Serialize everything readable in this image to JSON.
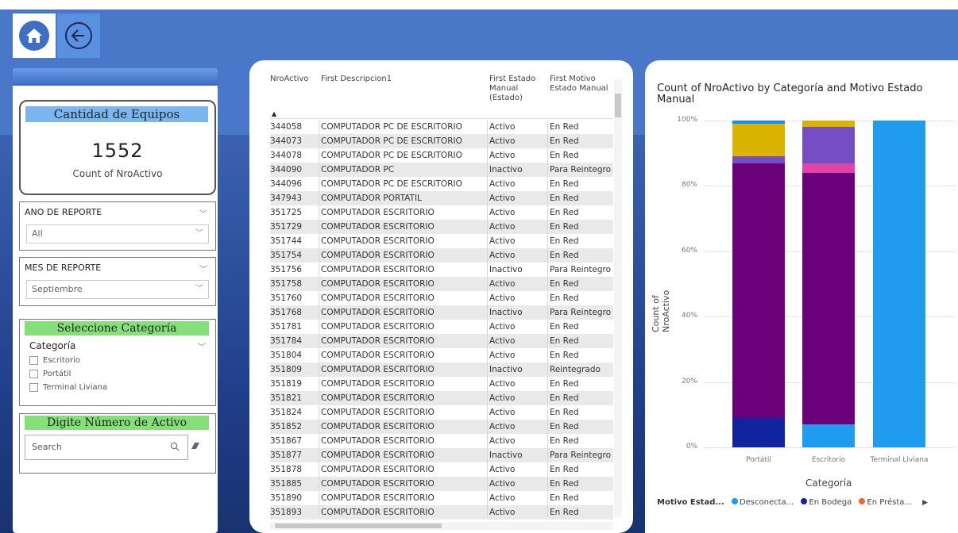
{
  "nav": {
    "home_icon": "home-icon",
    "back_icon": "back-arrow-icon"
  },
  "kpi": {
    "title": "Cantidad de Equipos",
    "value": "1552",
    "label": "Count of NroActivo"
  },
  "slicer_year": {
    "title": "ANO DE REPORTE",
    "value": "All"
  },
  "slicer_month": {
    "title": "MES DE REPORTE",
    "value": "Septiembre"
  },
  "category_slicer": {
    "banner": "Seleccione Categoría",
    "header": "Categoría",
    "items": [
      "Escritorio",
      "Portátil",
      "Terminal Liviana"
    ]
  },
  "asset_search": {
    "banner": "Digite Número de Activo",
    "placeholder": "Search"
  },
  "table": {
    "columns": [
      "NroActivo",
      "First Descripcion1",
      "First Estado Manual (Estado)",
      "First Motivo Estado Manual"
    ],
    "rows": [
      [
        "344058",
        "COMPUTADOR PC DE ESCRITORIO",
        "Activo",
        "En Red"
      ],
      [
        "344073",
        "COMPUTADOR PC DE ESCRITORIO",
        "Activo",
        "En Red"
      ],
      [
        "344078",
        "COMPUTADOR PC DE ESCRITORIO",
        "Activo",
        "En Red"
      ],
      [
        "344090",
        "COMPUTADOR PC",
        "Inactivo",
        "Para Reintegro"
      ],
      [
        "344096",
        "COMPUTADOR PC DE ESCRITORIO",
        "Activo",
        "En Red"
      ],
      [
        "347943",
        "COMPUTADOR PORTATIL",
        "Activo",
        "En Red"
      ],
      [
        "351725",
        "COMPUTADOR ESCRITORIO",
        "Activo",
        "En Red"
      ],
      [
        "351729",
        "COMPUTADOR ESCRITORIO",
        "Activo",
        "En Red"
      ],
      [
        "351744",
        "COMPUTADOR ESCRITORIO",
        "Activo",
        "En Red"
      ],
      [
        "351754",
        "COMPUTADOR ESCRITORIO",
        "Activo",
        "En Red"
      ],
      [
        "351756",
        "COMPUTADOR ESCRITORIO",
        "Inactivo",
        "Para Reintegro"
      ],
      [
        "351758",
        "COMPUTADOR ESCRITORIO",
        "Activo",
        "En Red"
      ],
      [
        "351760",
        "COMPUTADOR ESCRITORIO",
        "Activo",
        "En Red"
      ],
      [
        "351768",
        "COMPUTADOR ESCRITORIO",
        "Inactivo",
        "Para Reintegro"
      ],
      [
        "351781",
        "COMPUTADOR ESCRITORIO",
        "Activo",
        "En Red"
      ],
      [
        "351784",
        "COMPUTADOR ESCRITORIO",
        "Activo",
        "En Red"
      ],
      [
        "351804",
        "COMPUTADOR ESCRITORIO",
        "Activo",
        "En Red"
      ],
      [
        "351809",
        "COMPUTADOR ESCRITORIO",
        "Inactivo",
        "Reintegrado"
      ],
      [
        "351819",
        "COMPUTADOR ESCRITORIO",
        "Activo",
        "En Red"
      ],
      [
        "351821",
        "COMPUTADOR ESCRITORIO",
        "Activo",
        "En Red"
      ],
      [
        "351824",
        "COMPUTADOR ESCRITORIO",
        "Activo",
        "En Red"
      ],
      [
        "351852",
        "COMPUTADOR ESCRITORIO",
        "Activo",
        "En Red"
      ],
      [
        "351867",
        "COMPUTADOR ESCRITORIO",
        "Activo",
        "En Red"
      ],
      [
        "351877",
        "COMPUTADOR ESCRITORIO",
        "Inactivo",
        "Para Reintegro"
      ],
      [
        "351878",
        "COMPUTADOR ESCRITORIO",
        "Activo",
        "En Red"
      ],
      [
        "351885",
        "COMPUTADOR ESCRITORIO",
        "Activo",
        "En Red"
      ],
      [
        "351890",
        "COMPUTADOR ESCRITORIO",
        "Activo",
        "En Red"
      ],
      [
        "351893",
        "COMPUTADOR ESCRITORIO",
        "Activo",
        "En Red"
      ]
    ]
  },
  "chart_data": {
    "type": "bar",
    "stacked": true,
    "percent": true,
    "title": "Count of NroActivo by Categoría and Motivo Estado Manual",
    "xlabel": "Categoría",
    "ylabel": "Count of NroActivo",
    "ylim": [
      0,
      100
    ],
    "yticks": [
      "0%",
      "20%",
      "40%",
      "60%",
      "80%",
      "100%"
    ],
    "categories": [
      "Portátil",
      "Escritorio",
      "Terminal Liviana"
    ],
    "legend_title": "Motivo Estad...",
    "legend_entries": [
      "Desconecta...",
      "En Bodega",
      "En Présta..."
    ],
    "series": [
      {
        "color": "#1f9bf0",
        "values": [
          0,
          7,
          100
        ]
      },
      {
        "color": "#12239e",
        "values": [
          9,
          0,
          0
        ]
      },
      {
        "color": "#6b007b",
        "values": [
          78,
          77,
          0
        ]
      },
      {
        "color": "#e044a7",
        "values": [
          0,
          3,
          0
        ]
      },
      {
        "color": "#744ec2",
        "values": [
          2,
          11,
          0
        ]
      },
      {
        "color": "#d9b300",
        "values": [
          10,
          2,
          0
        ]
      },
      {
        "color": "#118dff",
        "values": [
          1,
          0,
          0
        ]
      }
    ]
  }
}
